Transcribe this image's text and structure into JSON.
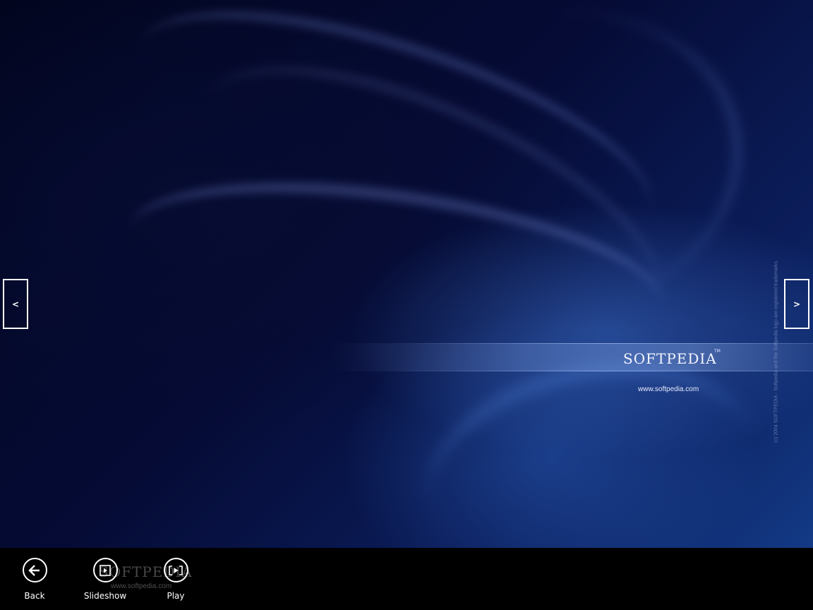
{
  "viewer": {
    "image": {
      "logo_text": "SOFTPEDIA",
      "trademark": "TM",
      "url_text": "www.softpedia.com",
      "side_note": "(c) 2004 SOFTPEDIA - Softpedia and the Softpedia logo are registered trademarks."
    },
    "prev_label": "<",
    "next_label": ">"
  },
  "appbar": {
    "back_label": "Back",
    "slideshow_label": "Slideshow",
    "play_label": "Play",
    "ghost_logo": "SOFTPEDIA",
    "ghost_url": "www.softpedia.com"
  },
  "colors": {
    "background": "#000000",
    "wallpaper_dark": "#02051e",
    "wallpaper_light": "#133a86",
    "foreground": "#ffffff"
  },
  "icons": {
    "back": "back-arrow-icon",
    "slideshow": "slideshow-icon",
    "play": "play-icon"
  }
}
